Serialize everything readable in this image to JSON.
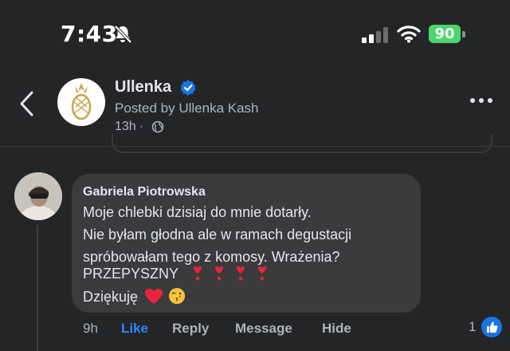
{
  "status_bar": {
    "time": "7:43",
    "battery": "90",
    "icons": [
      "bell-slash-icon",
      "signal-icon",
      "wifi-icon",
      "battery-icon"
    ]
  },
  "header": {
    "page_name": "Ullenka",
    "posted_by": "Posted by Ullenka Kash",
    "time": "13h",
    "separator": "·",
    "icons": [
      "back-icon",
      "verified-badge-icon",
      "globe-icon",
      "more-icon"
    ]
  },
  "comment": {
    "author": "Gabriela Piotrowska",
    "lines": [
      "Moje chlebki dzisiaj do mnie dotarły.",
      "Nie byłam głodna ale w ramach degustacji",
      "spróbowałam tego z komosy. Wrażenia?",
      "PRZEPYSZNY",
      "Dziękuję"
    ],
    "emoji": [
      "heart-exclamation-icon",
      "red-heart-icon",
      "face-blowing-kiss-icon"
    ],
    "actions": {
      "time": "9h",
      "like": "Like",
      "reply": "Reply",
      "message": "Message",
      "hide": "Hide"
    },
    "reaction_count": "1"
  },
  "colors": {
    "background": "#242526",
    "bubble": "#3a3b3c",
    "accent": "#2d88ff",
    "battery": "#4ad66d",
    "verified": "#1b74e4"
  }
}
